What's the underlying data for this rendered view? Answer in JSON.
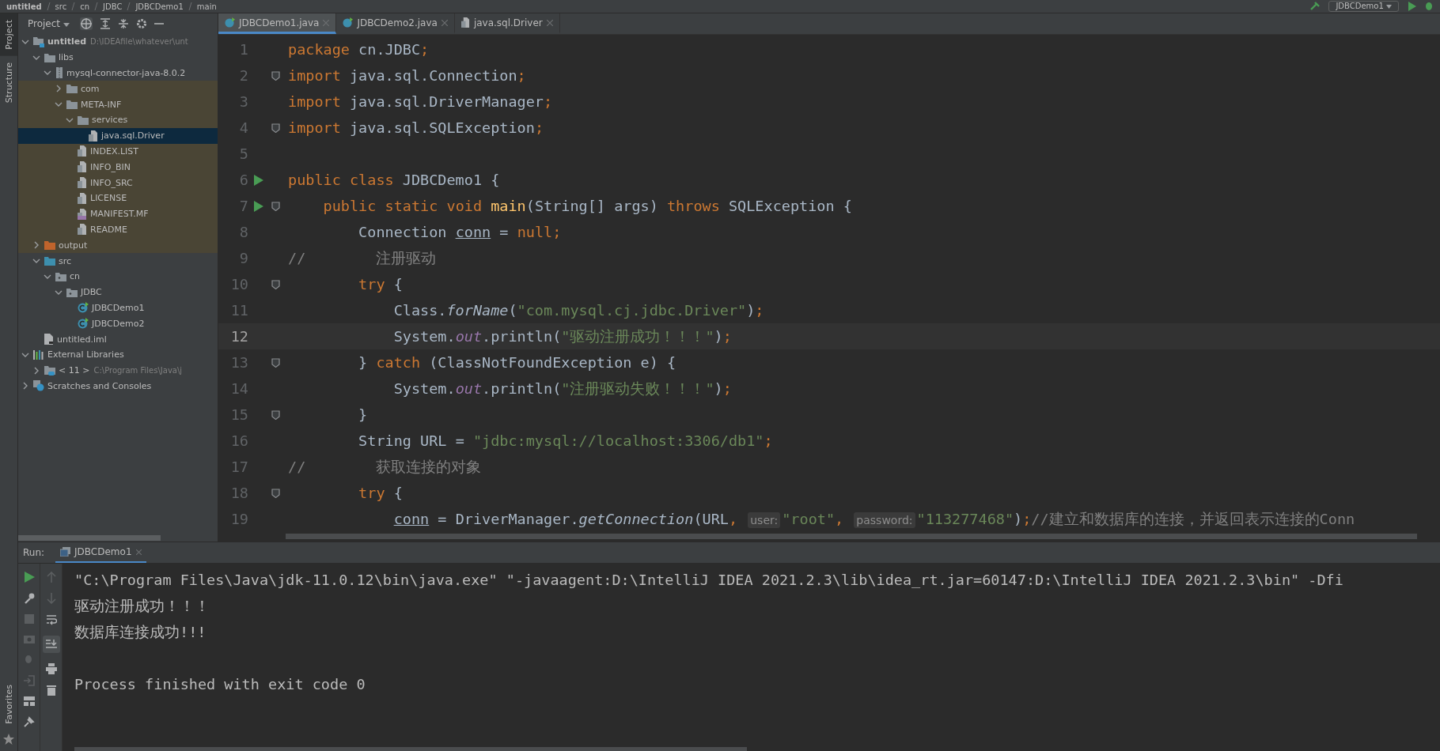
{
  "breadcrumbs": [
    "untitled",
    "src",
    "cn",
    "JDBC",
    "JDBCDemo1",
    "main"
  ],
  "run_config": "JDBCDemo1",
  "side_tabs": [
    {
      "label": "Project",
      "selected": true
    },
    {
      "label": "Structure",
      "selected": false
    }
  ],
  "bottom_side_tabs": [
    {
      "label": "Favorites",
      "selected": false
    }
  ],
  "project_panel": {
    "title": "Project",
    "tree": [
      {
        "label": "untitled",
        "path": "D:\\IDEAfile\\whatever\\unt",
        "kind": "module",
        "expanded": true,
        "selected": false,
        "library": false,
        "children": [
          {
            "label": "libs",
            "kind": "folder",
            "expanded": true,
            "selected": false,
            "library": false,
            "children": [
              {
                "label": "mysql-connector-java-8.0.2",
                "kind": "jar",
                "expanded": true,
                "selected": false,
                "library": false,
                "children": [
                  {
                    "label": "com",
                    "kind": "folder",
                    "expanded": false,
                    "selected": false,
                    "library": true
                  },
                  {
                    "label": "META-INF",
                    "kind": "folder",
                    "expanded": true,
                    "selected": false,
                    "library": true,
                    "children": [
                      {
                        "label": "services",
                        "kind": "folder",
                        "expanded": true,
                        "selected": false,
                        "library": true,
                        "children": [
                          {
                            "label": "java.sql.Driver",
                            "kind": "file",
                            "selected": true,
                            "library": true
                          }
                        ]
                      },
                      {
                        "label": "INDEX.LIST",
                        "kind": "file",
                        "selected": false,
                        "library": true
                      },
                      {
                        "label": "INFO_BIN",
                        "kind": "file",
                        "selected": false,
                        "library": true
                      },
                      {
                        "label": "INFO_SRC",
                        "kind": "file",
                        "selected": false,
                        "library": true
                      },
                      {
                        "label": "LICENSE",
                        "kind": "file",
                        "selected": false,
                        "library": true
                      },
                      {
                        "label": "MANIFEST.MF",
                        "kind": "manifest",
                        "selected": false,
                        "library": true
                      },
                      {
                        "label": "README",
                        "kind": "file",
                        "selected": false,
                        "library": true
                      }
                    ]
                  }
                ]
              }
            ]
          },
          {
            "label": "output",
            "kind": "output-folder",
            "expanded": false,
            "selected": false,
            "library": true
          },
          {
            "label": "src",
            "kind": "source-folder",
            "expanded": true,
            "selected": false,
            "library": false,
            "children": [
              {
                "label": "cn",
                "kind": "package",
                "expanded": true,
                "selected": false,
                "library": false,
                "children": [
                  {
                    "label": "JDBC",
                    "kind": "package",
                    "expanded": true,
                    "selected": false,
                    "library": false,
                    "children": [
                      {
                        "label": "JDBCDemo1",
                        "kind": "class",
                        "selected": false,
                        "library": false
                      },
                      {
                        "label": "JDBCDemo2",
                        "kind": "class",
                        "selected": false,
                        "library": false
                      }
                    ]
                  }
                ]
              }
            ]
          },
          {
            "label": "untitled.iml",
            "kind": "iml",
            "selected": false,
            "library": false
          }
        ]
      },
      {
        "label": "External Libraries",
        "kind": "libraries",
        "expanded": true,
        "selected": false,
        "library": false,
        "children": [
          {
            "label": "< 11 >",
            "path": "C:\\Program Files\\Java\\j",
            "kind": "sdk",
            "expanded": false,
            "selected": false,
            "library": false
          }
        ]
      },
      {
        "label": "Scratches and Consoles",
        "kind": "scratches",
        "expanded": false,
        "selected": false,
        "library": false
      }
    ]
  },
  "editor_tabs": [
    {
      "label": "JDBCDemo1.java",
      "kind": "class",
      "selected": true
    },
    {
      "label": "JDBCDemo2.java",
      "kind": "class",
      "selected": false
    },
    {
      "label": "java.sql.Driver",
      "kind": "file",
      "selected": false
    }
  ],
  "code_lines": [
    {
      "number": "1",
      "run": false,
      "fold": false,
      "current": false,
      "tokens": [
        {
          "kind": "keyword",
          "text": "package"
        },
        {
          "kind": "plain",
          "text": " cn.JDBC"
        },
        {
          "kind": "keyword",
          "text": ";"
        }
      ]
    },
    {
      "number": "2",
      "run": false,
      "fold": true,
      "current": false,
      "tokens": [
        {
          "kind": "keyword",
          "text": "import"
        },
        {
          "kind": "plain",
          "text": " java.sql.Connection"
        },
        {
          "kind": "keyword",
          "text": ";"
        }
      ]
    },
    {
      "number": "3",
      "run": false,
      "fold": false,
      "current": false,
      "tokens": [
        {
          "kind": "keyword",
          "text": "import"
        },
        {
          "kind": "plain",
          "text": " java.sql.DriverManager"
        },
        {
          "kind": "keyword",
          "text": ";"
        }
      ]
    },
    {
      "number": "4",
      "run": false,
      "fold": true,
      "current": false,
      "tokens": [
        {
          "kind": "keyword",
          "text": "import"
        },
        {
          "kind": "plain",
          "text": " java.sql.SQLException"
        },
        {
          "kind": "keyword",
          "text": ";"
        }
      ]
    },
    {
      "number": "5",
      "run": false,
      "fold": false,
      "current": false
    },
    {
      "number": "6",
      "run": true,
      "fold": false,
      "current": false,
      "tokens": [
        {
          "kind": "keyword",
          "text": "public class"
        },
        {
          "kind": "plain",
          "text": " JDBCDemo1 {"
        }
      ]
    },
    {
      "number": "7",
      "run": true,
      "fold": true,
      "current": false,
      "tokens": [
        {
          "kind": "keyword",
          "text": "    public static void "
        },
        {
          "kind": "function",
          "text": "main"
        },
        {
          "kind": "plain",
          "text": "(String[] args) "
        },
        {
          "kind": "keyword",
          "text": "throws"
        },
        {
          "kind": "plain",
          "text": " SQLException {"
        }
      ]
    },
    {
      "number": "8",
      "run": false,
      "fold": false,
      "current": false,
      "tokens": [
        {
          "kind": "plain",
          "text": "        Connection "
        },
        {
          "kind": "variable",
          "text": "conn"
        },
        {
          "kind": "plain",
          "text": " = "
        },
        {
          "kind": "keyword",
          "text": "null;"
        }
      ]
    },
    {
      "number": "9",
      "run": false,
      "fold": false,
      "current": false,
      "tokens": [
        {
          "kind": "comment",
          "text": "//        注册驱动"
        }
      ]
    },
    {
      "number": "10",
      "run": false,
      "fold": true,
      "current": false,
      "tokens": [
        {
          "kind": "keyword",
          "text": "        try"
        },
        {
          "kind": "plain",
          "text": " {"
        }
      ]
    },
    {
      "number": "11",
      "run": false,
      "fold": false,
      "current": false,
      "tokens": [
        {
          "kind": "plain",
          "text": "            Class."
        },
        {
          "kind": "method",
          "text": "forName"
        },
        {
          "kind": "plain",
          "text": "("
        },
        {
          "kind": "string",
          "text": "\"com.mysql.cj.jdbc.Driver\""
        },
        {
          "kind": "plain",
          "text": ")"
        },
        {
          "kind": "keyword",
          "text": ";"
        }
      ]
    },
    {
      "number": "12",
      "run": false,
      "fold": false,
      "current": true,
      "tokens": [
        {
          "kind": "plain",
          "text": "            System."
        },
        {
          "kind": "field",
          "text": "out"
        },
        {
          "kind": "plain",
          "text": ".println("
        },
        {
          "kind": "string",
          "text": "\"驱动注册成功！！！\""
        },
        {
          "kind": "plain",
          "text": ")"
        },
        {
          "kind": "keyword",
          "text": ";"
        }
      ]
    },
    {
      "number": "13",
      "run": false,
      "fold": true,
      "current": false,
      "tokens": [
        {
          "kind": "plain",
          "text": "        } "
        },
        {
          "kind": "keyword",
          "text": "catch"
        },
        {
          "kind": "plain",
          "text": " (ClassNotFoundException e) {"
        }
      ]
    },
    {
      "number": "14",
      "run": false,
      "fold": false,
      "current": false,
      "tokens": [
        {
          "kind": "plain",
          "text": "            System."
        },
        {
          "kind": "field",
          "text": "out"
        },
        {
          "kind": "plain",
          "text": ".println("
        },
        {
          "kind": "string",
          "text": "\"注册驱动失败！！！\""
        },
        {
          "kind": "plain",
          "text": ")"
        },
        {
          "kind": "keyword",
          "text": ";"
        }
      ]
    },
    {
      "number": "15",
      "run": false,
      "fold": true,
      "current": false,
      "tokens": [
        {
          "kind": "plain",
          "text": "        }"
        }
      ]
    },
    {
      "number": "16",
      "run": false,
      "fold": false,
      "current": false,
      "tokens": [
        {
          "kind": "plain",
          "text": "        String URL = "
        },
        {
          "kind": "string",
          "text": "\"jdbc:mysql://localhost:3306/db1\""
        },
        {
          "kind": "keyword",
          "text": ";"
        }
      ]
    },
    {
      "number": "17",
      "run": false,
      "fold": false,
      "current": false,
      "tokens": [
        {
          "kind": "comment",
          "text": "//        获取连接的对象"
        }
      ]
    },
    {
      "number": "18",
      "run": false,
      "fold": true,
      "current": false,
      "tokens": [
        {
          "kind": "keyword",
          "text": "        try"
        },
        {
          "kind": "plain",
          "text": " {"
        }
      ]
    },
    {
      "number": "19",
      "run": false,
      "fold": false,
      "current": false,
      "tokens": [
        {
          "kind": "variable",
          "text": "            conn"
        },
        {
          "kind": "plain",
          "text": " = DriverManager."
        },
        {
          "kind": "method",
          "text": "getConnection"
        },
        {
          "kind": "plain",
          "text": "(URL"
        },
        {
          "kind": "keyword",
          "text": ", "
        },
        {
          "kind": "hint",
          "text": "user:"
        },
        {
          "kind": "string",
          "text": "\"root\""
        },
        {
          "kind": "keyword",
          "text": ", "
        },
        {
          "kind": "hint",
          "text": "password:"
        },
        {
          "kind": "string",
          "text": "\"113277468\""
        },
        {
          "kind": "plain",
          "text": ")"
        },
        {
          "kind": "keyword",
          "text": ";"
        },
        {
          "kind": "comment",
          "text": "//建立和数据库的连接，并返回表示连接的Conn"
        }
      ]
    }
  ],
  "run_panel": {
    "label": "Run:",
    "tab": "JDBCDemo1",
    "output": [
      "\"C:\\Program Files\\Java\\jdk-11.0.12\\bin\\java.exe\" \"-javaagent:D:\\IntelliJ IDEA 2021.2.3\\lib\\idea_rt.jar=60147:D:\\IntelliJ IDEA 2021.2.3\\bin\" -Dfi",
      "驱动注册成功！！！",
      "数据库连接成功!!!"
    ],
    "exit_message": "Process finished with exit code 0"
  }
}
